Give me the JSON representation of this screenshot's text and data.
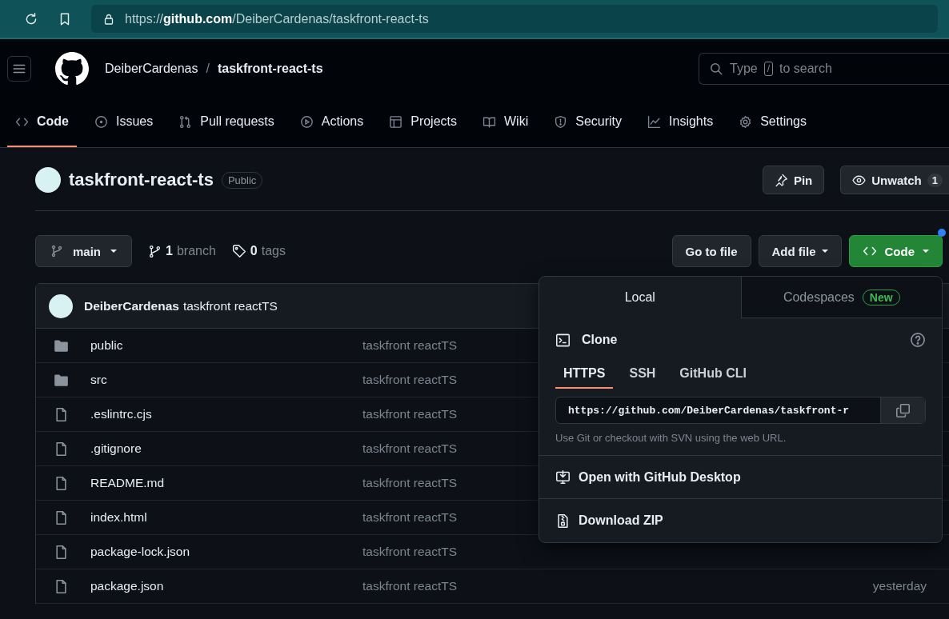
{
  "browser": {
    "url": "https://**github.com**/DeiberCardenas/taskfront-react-ts"
  },
  "header": {
    "owner": "DeiberCardenas",
    "separator": "/",
    "repo": "taskfront-react-ts",
    "search": {
      "placeholder": "Type",
      "key": "/",
      "placeholder_after": "to search"
    }
  },
  "nav": [
    {
      "label": "Code",
      "selected": true
    },
    {
      "label": "Issues",
      "selected": false
    },
    {
      "label": "Pull requests",
      "selected": false
    },
    {
      "label": "Actions",
      "selected": false
    },
    {
      "label": "Projects",
      "selected": false
    },
    {
      "label": "Wiki",
      "selected": false
    },
    {
      "label": "Security",
      "selected": false
    },
    {
      "label": "Insights",
      "selected": false
    },
    {
      "label": "Settings",
      "selected": false
    }
  ],
  "repo": {
    "name": "taskfront-react-ts",
    "visibility": "Public",
    "pin": "Pin",
    "watch": "Unwatch",
    "watch_count": "1"
  },
  "toolbar": {
    "branch": "main",
    "branch_count": "1",
    "branch_label": "branch",
    "tag_count": "0",
    "tag_label": "tags",
    "go_to_file": "Go to file",
    "add_file": "Add file",
    "code": "Code"
  },
  "latest_commit": {
    "author": "DeiberCardenas",
    "message": "taskfront reactTS"
  },
  "files": [
    {
      "kind": "folder",
      "name": "public",
      "commit": "taskfront reactTS"
    },
    {
      "kind": "folder",
      "name": "src",
      "commit": "taskfront reactTS"
    },
    {
      "kind": "file",
      "name": ".eslintrc.cjs",
      "commit": "taskfront reactTS"
    },
    {
      "kind": "file",
      "name": ".gitignore",
      "commit": "taskfront reactTS"
    },
    {
      "kind": "file",
      "name": "README.md",
      "commit": "taskfront reactTS"
    },
    {
      "kind": "file",
      "name": "index.html",
      "commit": "taskfront reactTS"
    },
    {
      "kind": "file",
      "name": "package-lock.json",
      "commit": "taskfront reactTS"
    },
    {
      "kind": "file",
      "name": "package.json",
      "commit": "taskfront reactTS",
      "date": "yesterday"
    }
  ],
  "clone_menu": {
    "tabs": [
      {
        "label": "Local",
        "selected": true
      },
      {
        "label": "Codespaces",
        "badge": "New",
        "selected": false
      }
    ],
    "title": "Clone",
    "protocols": [
      {
        "label": "HTTPS",
        "selected": true
      },
      {
        "label": "SSH",
        "selected": false
      },
      {
        "label": "GitHub CLI",
        "selected": false
      }
    ],
    "url": "https://github.com/DeiberCardenas/taskfront-r",
    "hint": "Use Git or checkout with SVN using the web URL.",
    "actions": [
      "Open with GitHub Desktop",
      "Download ZIP"
    ]
  }
}
